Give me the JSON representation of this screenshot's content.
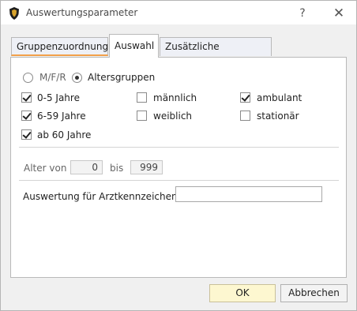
{
  "window": {
    "title": "Auswertungsparameter",
    "icon": "shield-icon",
    "help_label": "?",
    "close_label": "✕"
  },
  "tabs": [
    {
      "label": "Gruppenzuordnung",
      "selected": false
    },
    {
      "label": "Auswahl",
      "selected": true
    },
    {
      "label": "Zusätzliche Leistungen",
      "selected": false
    }
  ],
  "mode": {
    "mfr_label": "M/F/R",
    "mfr_selected": false,
    "alter_label": "Altersgruppen",
    "alter_selected": true
  },
  "age_groups": [
    {
      "label": "0-5 Jahre",
      "checked": true
    },
    {
      "label": "6-59 Jahre",
      "checked": true
    },
    {
      "label": "ab 60 Jahre",
      "checked": true
    }
  ],
  "gender": [
    {
      "label": "männlich",
      "checked": false
    },
    {
      "label": "weiblich",
      "checked": false
    }
  ],
  "care": [
    {
      "label": "ambulant",
      "checked": true
    },
    {
      "label": "stationär",
      "checked": false
    }
  ],
  "age_range": {
    "from_label": "Alter von",
    "from_value": "0",
    "to_label": "bis",
    "to_value": "999"
  },
  "doctor": {
    "label": "Auswertung für Arztkennzeichen",
    "value": ""
  },
  "buttons": {
    "ok": "OK",
    "cancel": "Abbrechen"
  },
  "colors": {
    "ok_button_bg": "#fdf7d0",
    "tab_underline": "#f2a04a"
  }
}
